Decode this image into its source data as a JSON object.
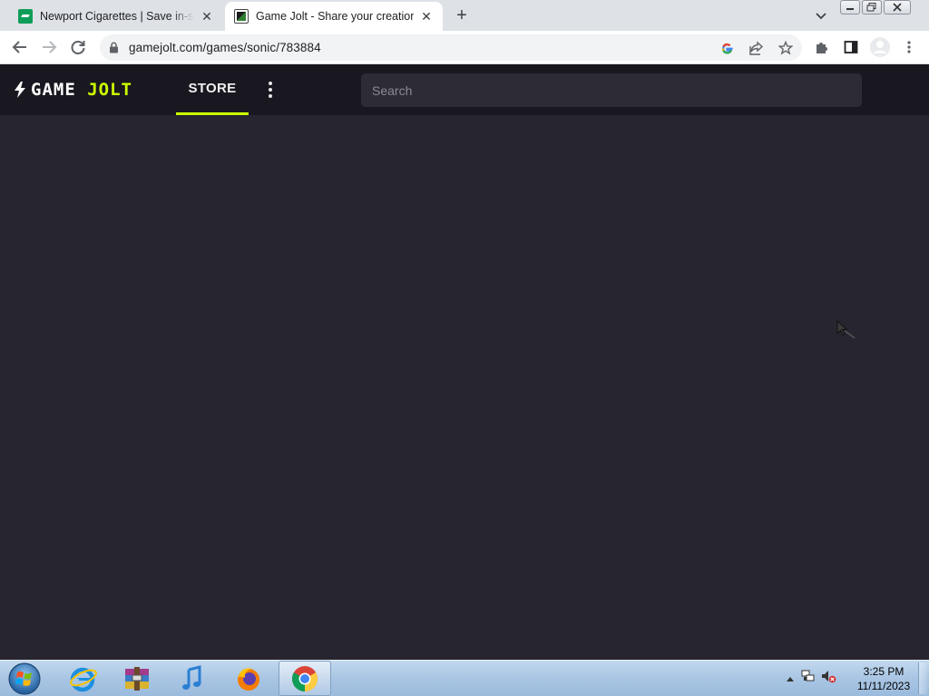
{
  "browser": {
    "tabs": [
      {
        "title": "Newport Cigarettes | Save in-stock",
        "favicon": "newport-favicon-icon",
        "active": false
      },
      {
        "title": "Game Jolt - Share your creations",
        "favicon": "gamejolt-favicon-icon",
        "active": true
      }
    ],
    "close_glyph": "✕",
    "new_tab_glyph": "+",
    "url": "gamejolt.com/games/sonic/783884"
  },
  "site": {
    "logo_left": "GAME",
    "logo_right": "JOLT",
    "nav_store": "STORE",
    "search_placeholder": "Search",
    "accent_color": "#ccff00",
    "header_bg": "#191820",
    "content_bg": "#27252f"
  },
  "taskbar": {
    "apps": [
      "start-orb-icon",
      "internet-explorer-icon",
      "winrar-icon",
      "itunes-icon",
      "firefox-icon",
      "chrome-icon"
    ],
    "time": "3:25 PM",
    "date": "11/11/2023"
  }
}
